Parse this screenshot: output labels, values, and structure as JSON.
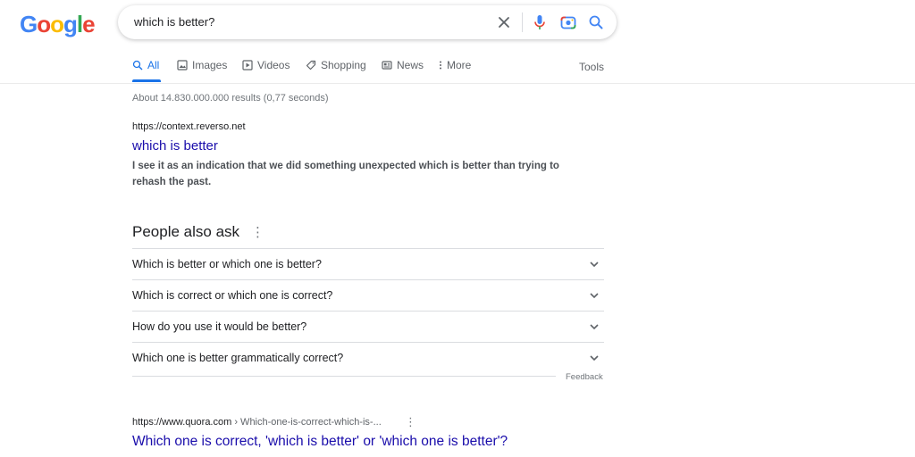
{
  "logo": {
    "letters": [
      "G",
      "o",
      "o",
      "g",
      "l",
      "e"
    ]
  },
  "search": {
    "query": "which is better?"
  },
  "icons": {
    "clear": "close-icon",
    "mic": "microphone-icon",
    "camera": "camera-lens-icon",
    "search": "search-icon",
    "more": "more-vert-icon",
    "chevron": "chevron-down-icon"
  },
  "tabs": [
    {
      "label": "All",
      "icon": "search-icon",
      "active": true
    },
    {
      "label": "Images",
      "icon": "images-icon"
    },
    {
      "label": "Videos",
      "icon": "video-icon"
    },
    {
      "label": "Shopping",
      "icon": "tag-icon"
    },
    {
      "label": "News",
      "icon": "news-icon"
    },
    {
      "label": "More",
      "icon": "more-vert-icon"
    }
  ],
  "tools_label": "Tools",
  "stats": "About 14.830.000.000 results (0,77 seconds)",
  "result1": {
    "url": "https://context.reverso.net",
    "title": "which is better",
    "snippet": "I see it as an indication that we did something unexpected which is better than trying to rehash the past."
  },
  "people_also_ask": {
    "title": "People also ask",
    "questions": [
      "Which is better or which one is better?",
      "Which is correct or which one is correct?",
      "How do you use it would be better?",
      "Which one is better grammatically correct?"
    ],
    "feedback": "Feedback"
  },
  "result2": {
    "url_domain": "https://www.quora.com",
    "url_path": " › Which-one-is-correct-which-is-...",
    "title": "Which one is correct, 'which is better' or 'which one is better'?"
  },
  "colors": {
    "link": "#1a0dab",
    "accent": "#1a73e8",
    "mic_blue": "#4285f4",
    "mic_red": "#ea4335",
    "lens_yellow": "#fbbc05",
    "lens_green": "#34a853"
  }
}
